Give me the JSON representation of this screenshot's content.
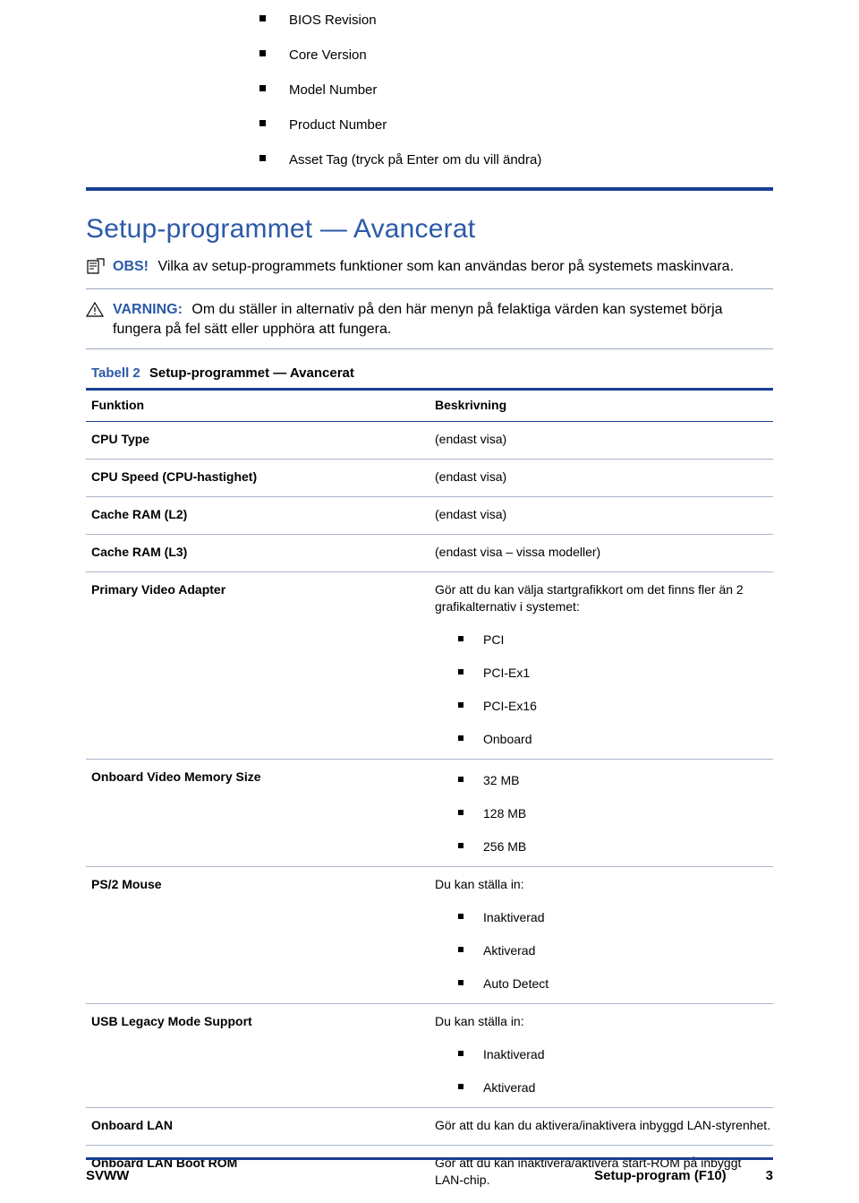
{
  "top_list": {
    "items": [
      "BIOS Revision",
      "Core Version",
      "Model Number",
      "Product Number",
      "Asset Tag (tryck på Enter om du vill ändra)"
    ]
  },
  "section": {
    "title": "Setup-programmet — Avancerat"
  },
  "notes": [
    {
      "icon": "note-icon",
      "label": "OBS!",
      "text": "Vilka av setup-programmets funktioner som kan användas beror på systemets maskinvara."
    },
    {
      "icon": "warning-icon",
      "label": "VARNING:",
      "text": "Om du ställer in alternativ på den här menyn på felaktiga värden kan systemet börja fungera på fel sätt eller upphöra att fungera."
    }
  ],
  "table": {
    "caption_label": "Tabell 2",
    "caption_text": "Setup-programmet — Avancerat",
    "headers": [
      "Funktion",
      "Beskrivning"
    ],
    "rows": [
      {
        "funktion": "CPU Type",
        "lead": "(endast visa)",
        "bullets": []
      },
      {
        "funktion": "CPU Speed (CPU-hastighet)",
        "lead": "(endast visa)",
        "bullets": []
      },
      {
        "funktion": "Cache RAM (L2)",
        "lead": "(endast visa)",
        "bullets": []
      },
      {
        "funktion": "Cache RAM (L3)",
        "lead": "(endast visa – vissa modeller)",
        "bullets": []
      },
      {
        "funktion": "Primary Video Adapter",
        "lead": "Gör att du kan välja startgrafikkort om det finns fler än 2 grafikalternativ i systemet:",
        "bullets": [
          "PCI",
          "PCI-Ex1",
          "PCI-Ex16",
          "Onboard"
        ]
      },
      {
        "funktion": "Onboard Video Memory Size",
        "lead": "",
        "bullets": [
          "32 MB",
          "128 MB",
          "256 MB"
        ]
      },
      {
        "funktion": "PS/2 Mouse",
        "lead": "Du kan ställa in:",
        "bullets": [
          "Inaktiverad",
          "Aktiverad",
          "Auto Detect"
        ]
      },
      {
        "funktion": "USB Legacy Mode Support",
        "lead": "Du kan ställa in:",
        "bullets": [
          "Inaktiverad",
          "Aktiverad"
        ]
      },
      {
        "funktion": "Onboard LAN",
        "lead": "Gör att du kan du aktivera/inaktivera inbyggd LAN-styrenhet.",
        "bullets": []
      },
      {
        "funktion": "Onboard LAN Boot ROM",
        "lead": "Gör att du kan inaktivera/aktivera start-ROM på inbyggt LAN-chip.",
        "bullets": []
      }
    ]
  },
  "footer": {
    "left": "SVWW",
    "chapter": "Setup-program (F10)",
    "page": "3"
  },
  "colors": {
    "accent_blue": "#2c5aa8",
    "rule_blue": "#1c3f94"
  }
}
